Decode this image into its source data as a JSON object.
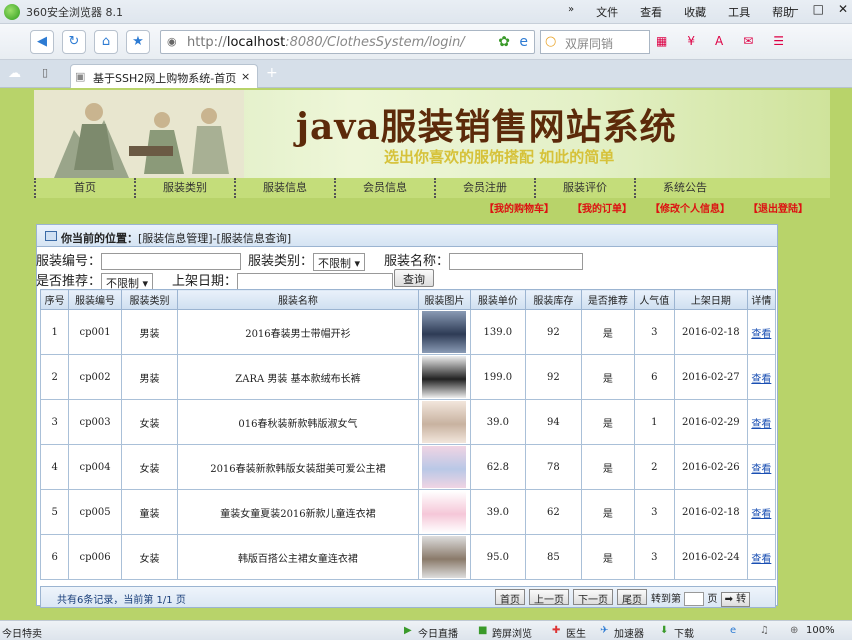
{
  "browser": {
    "title": "360安全浏览器 8.1",
    "menus": [
      "文件",
      "查看",
      "收藏",
      "工具",
      "帮助"
    ],
    "url_host": "localhost",
    "url_rest": ":8080/ClothesSystem/login/",
    "url_scheme": "http://",
    "search_placeholder": "双屏同销",
    "tab_title": "基于SSH2网上购物系统-首页",
    "tab_close": "×",
    "new_tab": "+"
  },
  "banner": {
    "title": "java服装销售网站系统",
    "subtitle": "选出你喜欢的服饰搭配 如此的简单"
  },
  "nav": [
    "首页",
    "服装类别",
    "服装信息",
    "会员信息",
    "会员注册",
    "服装评价",
    "系统公告"
  ],
  "subnav": [
    "【我的购物车】",
    "【我的订单】",
    "【修改个人信息】",
    "【退出登陆】"
  ],
  "panel": {
    "location_label": "你当前的位置：",
    "location_value": "[服装信息管理]-[服装信息查询]"
  },
  "search": {
    "code_label": "服装编号：",
    "type_label": "服装类别：",
    "type_value": "不限制",
    "name_label": "服装名称：",
    "recommend_label": "是否推荐：",
    "recommend_value": "不限制",
    "date_label": "上架日期：",
    "query_button": "查询"
  },
  "table": {
    "headers": [
      "序号",
      "服装编号",
      "服装类别",
      "服装名称",
      "服装图片",
      "服装单价",
      "服装库存",
      "是否推荐",
      "人气值",
      "上架日期",
      "详情"
    ],
    "rows": [
      {
        "no": "1",
        "code": "cp001",
        "type": "男装",
        "name": "2016春装男士带帽开衫",
        "price": "139.0",
        "stock": "92",
        "rec": "是",
        "pop": "3",
        "date": "2016-02-18",
        "link": "查看"
      },
      {
        "no": "2",
        "code": "cp002",
        "type": "男装",
        "name": "ZARA 男装 基本款绒布长裤",
        "price": "199.0",
        "stock": "92",
        "rec": "是",
        "pop": "6",
        "date": "2016-02-27",
        "link": "查看"
      },
      {
        "no": "3",
        "code": "cp003",
        "type": "女装",
        "name": "016春秋装新款韩版淑女气",
        "price": "39.0",
        "stock": "94",
        "rec": "是",
        "pop": "1",
        "date": "2016-02-29",
        "link": "查看"
      },
      {
        "no": "4",
        "code": "cp004",
        "type": "女装",
        "name": "2016春装新款韩版女装甜美可爱公主裙",
        "price": "62.8",
        "stock": "78",
        "rec": "是",
        "pop": "2",
        "date": "2016-02-26",
        "link": "查看"
      },
      {
        "no": "5",
        "code": "cp005",
        "type": "童装",
        "name": "童装女童夏装2016新款儿童连衣裙",
        "price": "39.0",
        "stock": "62",
        "rec": "是",
        "pop": "3",
        "date": "2016-02-18",
        "link": "查看"
      },
      {
        "no": "6",
        "code": "cp006",
        "type": "女装",
        "name": "韩版百搭公主裙女童连衣裙",
        "price": "95.0",
        "stock": "85",
        "rec": "是",
        "pop": "3",
        "date": "2016-02-24",
        "link": "查看"
      }
    ]
  },
  "pager": {
    "info": "共有6条记录，当前第 1/1 页",
    "buttons": [
      "首页",
      "上一页",
      "下一页",
      "尾页"
    ],
    "goto_label": "转到第",
    "page_suffix": "页",
    "go_button": "➡ 转"
  },
  "status": {
    "left": "今日特卖",
    "items": [
      "今日直播",
      "跨屏浏览",
      "医生",
      "加速器",
      "下载"
    ],
    "zoom": "100%"
  }
}
